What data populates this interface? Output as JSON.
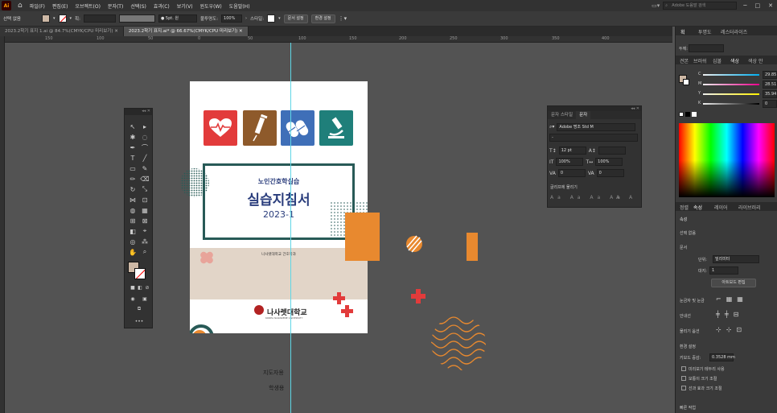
{
  "app": {
    "logo": "Ai"
  },
  "menu": [
    "파일(F)",
    "편집(E)",
    "오브젝트(O)",
    "문자(T)",
    "선택(S)",
    "효과(C)",
    "보기(V)",
    "윈도우(W)",
    "도움말(H)"
  ],
  "search": {
    "placeholder": "Adobe 도움말 검색"
  },
  "control": {
    "selection": "선택 없음",
    "stroke_label": "획:",
    "brush": "5pt. 원",
    "opacity_label": "불투명도:",
    "opacity": "100%",
    "style_label": "스타일:",
    "doc_setup": "문서 설정",
    "prefs": "환경 설정"
  },
  "tabs": [
    {
      "label": "2023.2학기 표지 1.ai @ 84.7%(CMYK/CPU 미리보기)"
    },
    {
      "label": "2023.2학기 표지.ai* @ 66.67%(CMYK/CPU 미리보기)"
    }
  ],
  "ruler": [
    "150",
    "100",
    "50",
    "0",
    "50",
    "100",
    "150",
    "200",
    "250",
    "300",
    "350",
    "400"
  ],
  "artboard": {
    "subtitle": "노인간호학실습",
    "title": "실습지침서",
    "year": "2023-1",
    "dept": "나사렛대학교 간호학과",
    "univ": "나사렛대학교",
    "univ_en": "KOREA NAZARENE UNIVERSITY"
  },
  "canvas_labels": {
    "label1": "지도자용",
    "label2": "학생용"
  },
  "char_panel": {
    "tab1": "문자 스타일",
    "tab2": "문자",
    "font": "Adobe 명조 Std M",
    "style": "-",
    "size": "12 pt",
    "scale_h": "100%",
    "scale_v": "100%",
    "tracking": "0",
    "kerning": "0",
    "opentype_label": "글리프에 물리기"
  },
  "right_panel": {
    "tabs_top": [
      "획",
      "투명도",
      "레스터라이즈"
    ],
    "tabs_mid": [
      "견본",
      "브러쉬",
      "심볼",
      "색상",
      "색상 안"
    ],
    "mode_label": "두께:",
    "c_label": "C",
    "c_val": "29.85",
    "m_label": "M",
    "m_val": "28.51",
    "y_label": "Y",
    "y_val": "35.94",
    "k_label": "K",
    "k_val": "0",
    "tabs_props": [
      "정렬",
      "속성",
      "레이어",
      "라이브러리"
    ],
    "props_header": "속성",
    "props_sel": "선택 없음",
    "doc_label": "문서",
    "unit_label": "단위:",
    "unit_val": "밀리미터",
    "artboard_label": "대지:",
    "artboard_val": "1",
    "edit_artboard": "아트보드 편집",
    "rulers_grid": "눈금자 및 눈금",
    "guides": "안내선",
    "snap": "물리기 옵션",
    "prefs_label": "환경 설정",
    "keyboard_label": "키보드 증감:",
    "keyboard_val": "0.3528 mm",
    "chk1": "미리보기 테두리 사용",
    "chk2": "모퉁이 크기 조절",
    "chk3": "선과 효과 크기 조절",
    "quick": "빠른 작업"
  },
  "colors": {
    "fill": "#cdb8a5",
    "accent_red": "#e23b3b",
    "accent_orange": "#e8892f",
    "teal": "#285a57"
  }
}
